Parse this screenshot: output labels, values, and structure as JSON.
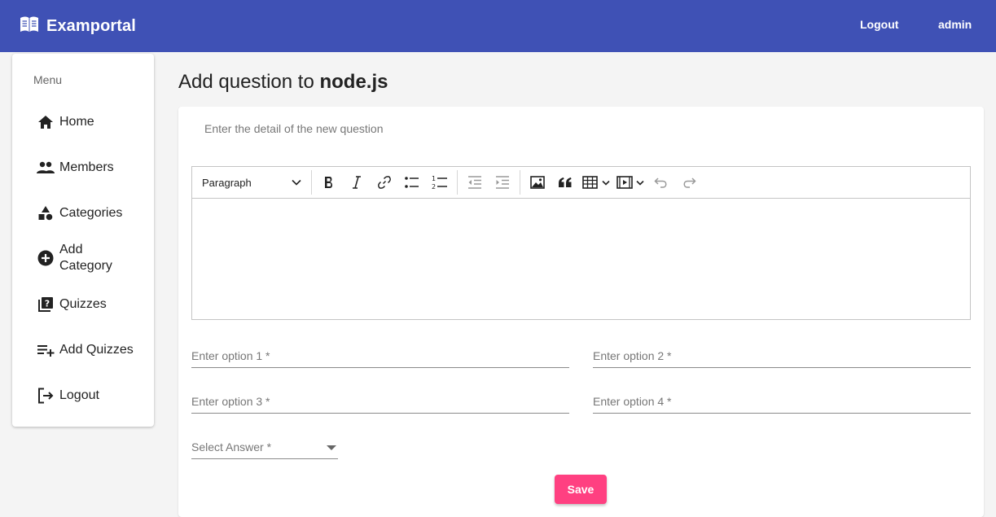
{
  "header": {
    "title": "Examportal",
    "brand_icon": "book-icon",
    "logout_label": "Logout",
    "user_label": "admin",
    "color": "#3f51b5"
  },
  "sidebar": {
    "menu_label": "Menu",
    "items": [
      {
        "label": "Home",
        "icon": "home-icon"
      },
      {
        "label": "Members",
        "icon": "people-icon"
      },
      {
        "label": "Categories",
        "icon": "category-icon"
      },
      {
        "label": "Add Category",
        "icon": "add-circle-icon"
      },
      {
        "label": "Quizzes",
        "icon": "quiz-icon"
      },
      {
        "label": "Add Quizzes",
        "icon": "playlist-add-icon"
      },
      {
        "label": "Logout",
        "icon": "logout-icon"
      }
    ]
  },
  "main": {
    "heading_prefix": "Add question to",
    "heading_subject": "node.js",
    "subtitle": "Enter the detail of the new question",
    "editor": {
      "heading_select": "Paragraph",
      "toolbar_icons": [
        "bold-icon",
        "italic-icon",
        "link-icon",
        "bulleted-list-icon",
        "numbered-list-icon",
        "outdent-icon",
        "indent-icon",
        "image-icon",
        "quote-icon",
        "table-icon",
        "media-icon",
        "undo-icon",
        "redo-icon"
      ]
    },
    "option1_label": "Enter option 1 *",
    "option2_label": "Enter option 2 *",
    "option3_label": "Enter option 3 *",
    "option4_label": "Enter option 4 *",
    "answer_label": "Select Answer *",
    "save_label": "Save",
    "save_color": "#ff4081"
  }
}
